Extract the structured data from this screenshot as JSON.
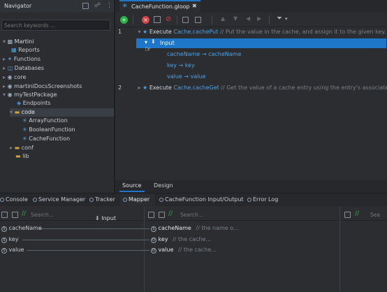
{
  "navigator": {
    "title": "Navigator",
    "search_placeholder": "Search keywords ...",
    "tree": {
      "root": "Martini",
      "reports": "Reports",
      "functions": "Functions",
      "databases": "Databases",
      "core": "core",
      "docs": "martiniDocsScreenshots",
      "package": "myTestPackage",
      "endpoints": "Endpoints",
      "code": "code",
      "array_fn": "ArrayFunction",
      "boolean_fn": "BooleanFunction",
      "cache_fn": "CacheFunction",
      "conf": "conf",
      "lib": "lib"
    }
  },
  "editor": {
    "tab_title": "CacheFunction.gloop",
    "steps": [
      {
        "num": "1",
        "keyword": "Execute",
        "target": "Cache.cachePut",
        "comment": "// Put the value in the cache, and assign it to the given key."
      },
      {
        "num": "2",
        "keyword": "Execute",
        "target": "Cache.cacheGet",
        "comment": "// Get the value of a cache entry using the entry's associated key."
      }
    ],
    "input_label": "Input",
    "mappings": [
      "cacheName → cacheName",
      "key → key",
      "value → value"
    ],
    "bottom_tabs": {
      "source": "Source",
      "design": "Design"
    }
  },
  "panel_tabs": {
    "console": "Console",
    "service_manager": "Service Manager",
    "tracker": "Tracker",
    "mapper": "Mapper",
    "io": "CacheFunction Input/Output",
    "error_log": "Error Log"
  },
  "mapper": {
    "search_placeholder": "Search...",
    "right_search_placeholder": "Sea",
    "input_box": "Input",
    "left_fields": [
      "cacheName",
      "key",
      "value"
    ],
    "right_fields": [
      {
        "name": "cacheName",
        "comment": "// the name o..."
      },
      {
        "name": "key",
        "comment": "// the cache..."
      },
      {
        "name": "value",
        "comment": "// the cache..."
      }
    ]
  },
  "colors": {
    "accent": "#1e76c9",
    "run": "#2fb04a",
    "stop": "#d64545",
    "folder": "#d6a33b"
  }
}
